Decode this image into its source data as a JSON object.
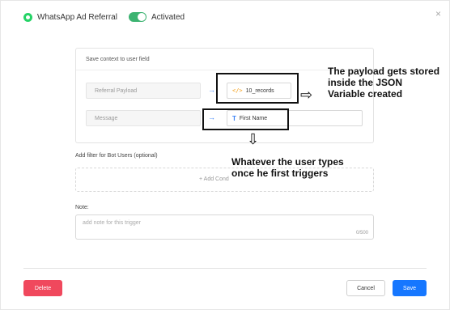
{
  "header": {
    "title": "WhatsApp Ad Referral",
    "status": "Activated",
    "close_glyph": "×"
  },
  "context": {
    "title": "Save context to user field",
    "rows": [
      {
        "source": "Referral Payload",
        "target": "10_records",
        "icon": "code-icon"
      },
      {
        "source": "Message",
        "target": "First Name",
        "icon": "text-field-icon"
      }
    ],
    "arrow_glyph": "→"
  },
  "filter": {
    "label": "Add filter for Bot Users (optional)",
    "add_text": "+ Add Cond"
  },
  "note": {
    "label": "Note:",
    "placeholder": "add note for this trigger",
    "count": "0/500"
  },
  "footer": {
    "delete_label": "Delete",
    "cancel_label": "Cancel",
    "save_label": "Save"
  },
  "annotations": {
    "payload_note": "The payload gets stored inside the JSON Variable created",
    "message_note": "Whatever the user types once he first triggers",
    "right_arrow": "⇨",
    "down_arrow": "⇩"
  },
  "colors": {
    "accent": "#1677ff",
    "danger": "#f0485d",
    "toggle": "#3cb371",
    "whatsapp": "#25d366"
  }
}
